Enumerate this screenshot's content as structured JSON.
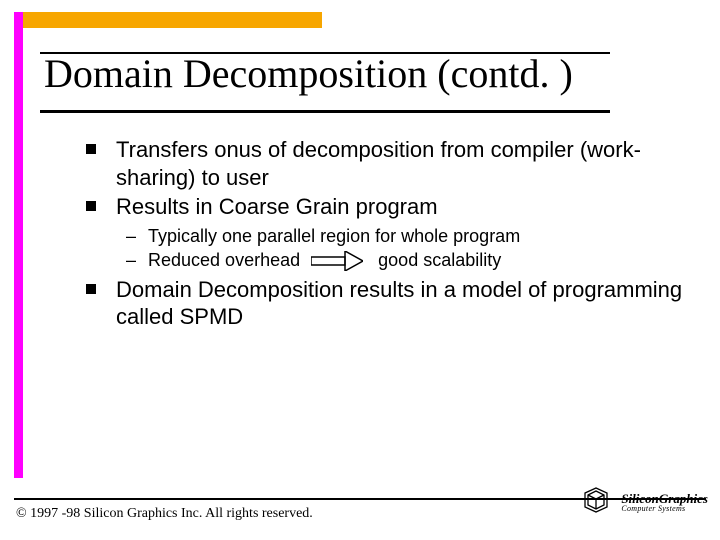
{
  "title": "Domain Decomposition (contd. )",
  "bullets": {
    "b1": "Transfers onus of decomposition from compiler (work-sharing) to user",
    "b2": "Results in Coarse Grain program",
    "sub1": "Typically one parallel region for whole program",
    "sub2a": "Reduced overhead",
    "sub2b": "good scalability",
    "b3": "Domain Decomposition results in a model of programming called SPMD"
  },
  "copyright": "© 1997 -98 Silicon Graphics Inc. All rights reserved.",
  "logo": {
    "line1": "SiliconGraphics",
    "line2": "Computer Systems"
  }
}
